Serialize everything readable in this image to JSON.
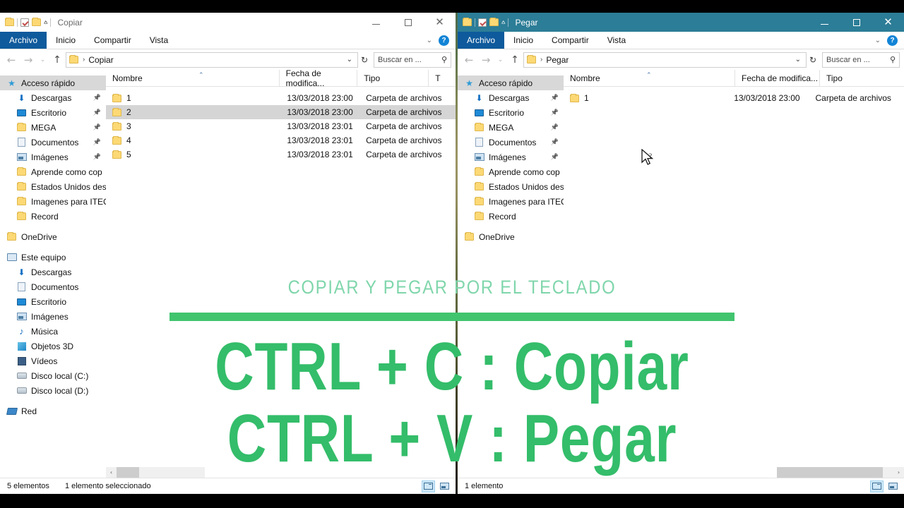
{
  "overlay": {
    "title": "COPIAR Y PEGAR POR EL TECLADO",
    "line1": "CTRL + C : Copiar",
    "line2": "CTRL + V : Pegar",
    "accent_green": "#34bd6a",
    "title_green": "#7fd6ab",
    "rule_green": "#41c46e"
  },
  "windows": [
    {
      "id": "copiar",
      "title": "Copiar",
      "titlebar_color": "#ffffff",
      "file_tab_color": "#0e5a9c",
      "ribbon_tabs": [
        {
          "label": "Archivo"
        },
        {
          "label": "Inicio"
        },
        {
          "label": "Compartir"
        },
        {
          "label": "Vista"
        }
      ],
      "address": {
        "path": "Copiar"
      },
      "search": {
        "placeholder": "Buscar en ..."
      },
      "columns": [
        {
          "label": "Nombre"
        },
        {
          "label": "Fecha de modifica..."
        },
        {
          "label": "Tipo"
        },
        {
          "label": "T"
        }
      ],
      "rows": [
        {
          "name": "1",
          "date": "13/03/2018 23:00",
          "type": "Carpeta de archivos",
          "selected": false
        },
        {
          "name": "2",
          "date": "13/03/2018 23:00",
          "type": "Carpeta de archivos",
          "selected": true
        },
        {
          "name": "3",
          "date": "13/03/2018 23:01",
          "type": "Carpeta de archivos",
          "selected": false
        },
        {
          "name": "4",
          "date": "13/03/2018 23:01",
          "type": "Carpeta de archivos",
          "selected": false
        },
        {
          "name": "5",
          "date": "13/03/2018 23:01",
          "type": "Carpeta de archivos",
          "selected": false
        }
      ],
      "status": {
        "count": "5 elementos",
        "selection": "1 elemento seleccionado"
      }
    },
    {
      "id": "pegar",
      "title": "Pegar",
      "titlebar_color": "#2c7d97",
      "file_tab_color": "#0e5a9c",
      "ribbon_tabs": [
        {
          "label": "Archivo"
        },
        {
          "label": "Inicio"
        },
        {
          "label": "Compartir"
        },
        {
          "label": "Vista"
        }
      ],
      "address": {
        "path": "Pegar"
      },
      "search": {
        "placeholder": "Buscar en ..."
      },
      "columns": [
        {
          "label": "Nombre"
        },
        {
          "label": "Fecha de modifica..."
        },
        {
          "label": "Tipo"
        }
      ],
      "rows": [
        {
          "name": "1",
          "date": "13/03/2018 23:00",
          "type": "Carpeta de archivos",
          "selected": false
        }
      ],
      "status": {
        "count": "1 elemento"
      }
    }
  ],
  "nav_pane": {
    "items": [
      {
        "label": "Acceso rápido",
        "icon": "star-icon",
        "indent": 0,
        "selected": true,
        "pinned": false
      },
      {
        "label": "Descargas",
        "icon": "download-icon",
        "indent": 1,
        "selected": false,
        "pinned": true
      },
      {
        "label": "Escritorio",
        "icon": "desktop-icon",
        "indent": 1,
        "selected": false,
        "pinned": true
      },
      {
        "label": "MEGA",
        "icon": "folder-icon",
        "indent": 1,
        "selected": false,
        "pinned": true
      },
      {
        "label": "Documentos",
        "icon": "document-icon",
        "indent": 1,
        "selected": false,
        "pinned": true
      },
      {
        "label": "Imágenes",
        "icon": "pictures-icon",
        "indent": 1,
        "selected": false,
        "pinned": true
      },
      {
        "label": "Aprende como cop",
        "icon": "folder-icon",
        "indent": 1,
        "selected": false,
        "pinned": false
      },
      {
        "label": "Estados Unidos des",
        "icon": "folder-icon",
        "indent": 1,
        "selected": false,
        "pinned": false
      },
      {
        "label": "Imagenes para ITEC",
        "icon": "folder-icon",
        "indent": 1,
        "selected": false,
        "pinned": false
      },
      {
        "label": "Record",
        "icon": "folder-icon",
        "indent": 1,
        "selected": false,
        "pinned": false
      },
      {
        "label": "OneDrive",
        "icon": "folder-icon",
        "indent": 0,
        "selected": false,
        "pinned": false
      },
      {
        "label": "Este equipo",
        "icon": "pc-icon",
        "indent": 0,
        "selected": false,
        "pinned": false
      },
      {
        "label": "Descargas",
        "icon": "download-icon",
        "indent": 1,
        "selected": false,
        "pinned": false
      },
      {
        "label": "Documentos",
        "icon": "document-icon",
        "indent": 1,
        "selected": false,
        "pinned": false
      },
      {
        "label": "Escritorio",
        "icon": "desktop-icon",
        "indent": 1,
        "selected": false,
        "pinned": false
      },
      {
        "label": "Imágenes",
        "icon": "pictures-icon",
        "indent": 1,
        "selected": false,
        "pinned": false
      },
      {
        "label": "Música",
        "icon": "music-icon",
        "indent": 1,
        "selected": false,
        "pinned": false
      },
      {
        "label": "Objetos 3D",
        "icon": "objects3d-icon",
        "indent": 1,
        "selected": false,
        "pinned": false
      },
      {
        "label": "Vídeos",
        "icon": "video-icon",
        "indent": 1,
        "selected": false,
        "pinned": false
      },
      {
        "label": "Disco local (C:)",
        "icon": "harddrive-icon",
        "indent": 1,
        "selected": false,
        "pinned": false
      },
      {
        "label": "Disco local (D:)",
        "icon": "harddrive-icon",
        "indent": 1,
        "selected": false,
        "pinned": false
      },
      {
        "label": "Red",
        "icon": "network-icon",
        "indent": 0,
        "selected": false,
        "pinned": false
      }
    ]
  },
  "icons": {
    "back": "←",
    "forward": "→",
    "recent": "⌄",
    "up": "↑",
    "dropdown": "⌄",
    "refresh": "↻",
    "search": "⚲",
    "chevron_left": "‹",
    "chevron_right": "›",
    "minimize": "–",
    "maximize": "□",
    "close": "✕",
    "help": "?",
    "sort_caret": "⌃",
    "crumb_sep": "›"
  }
}
